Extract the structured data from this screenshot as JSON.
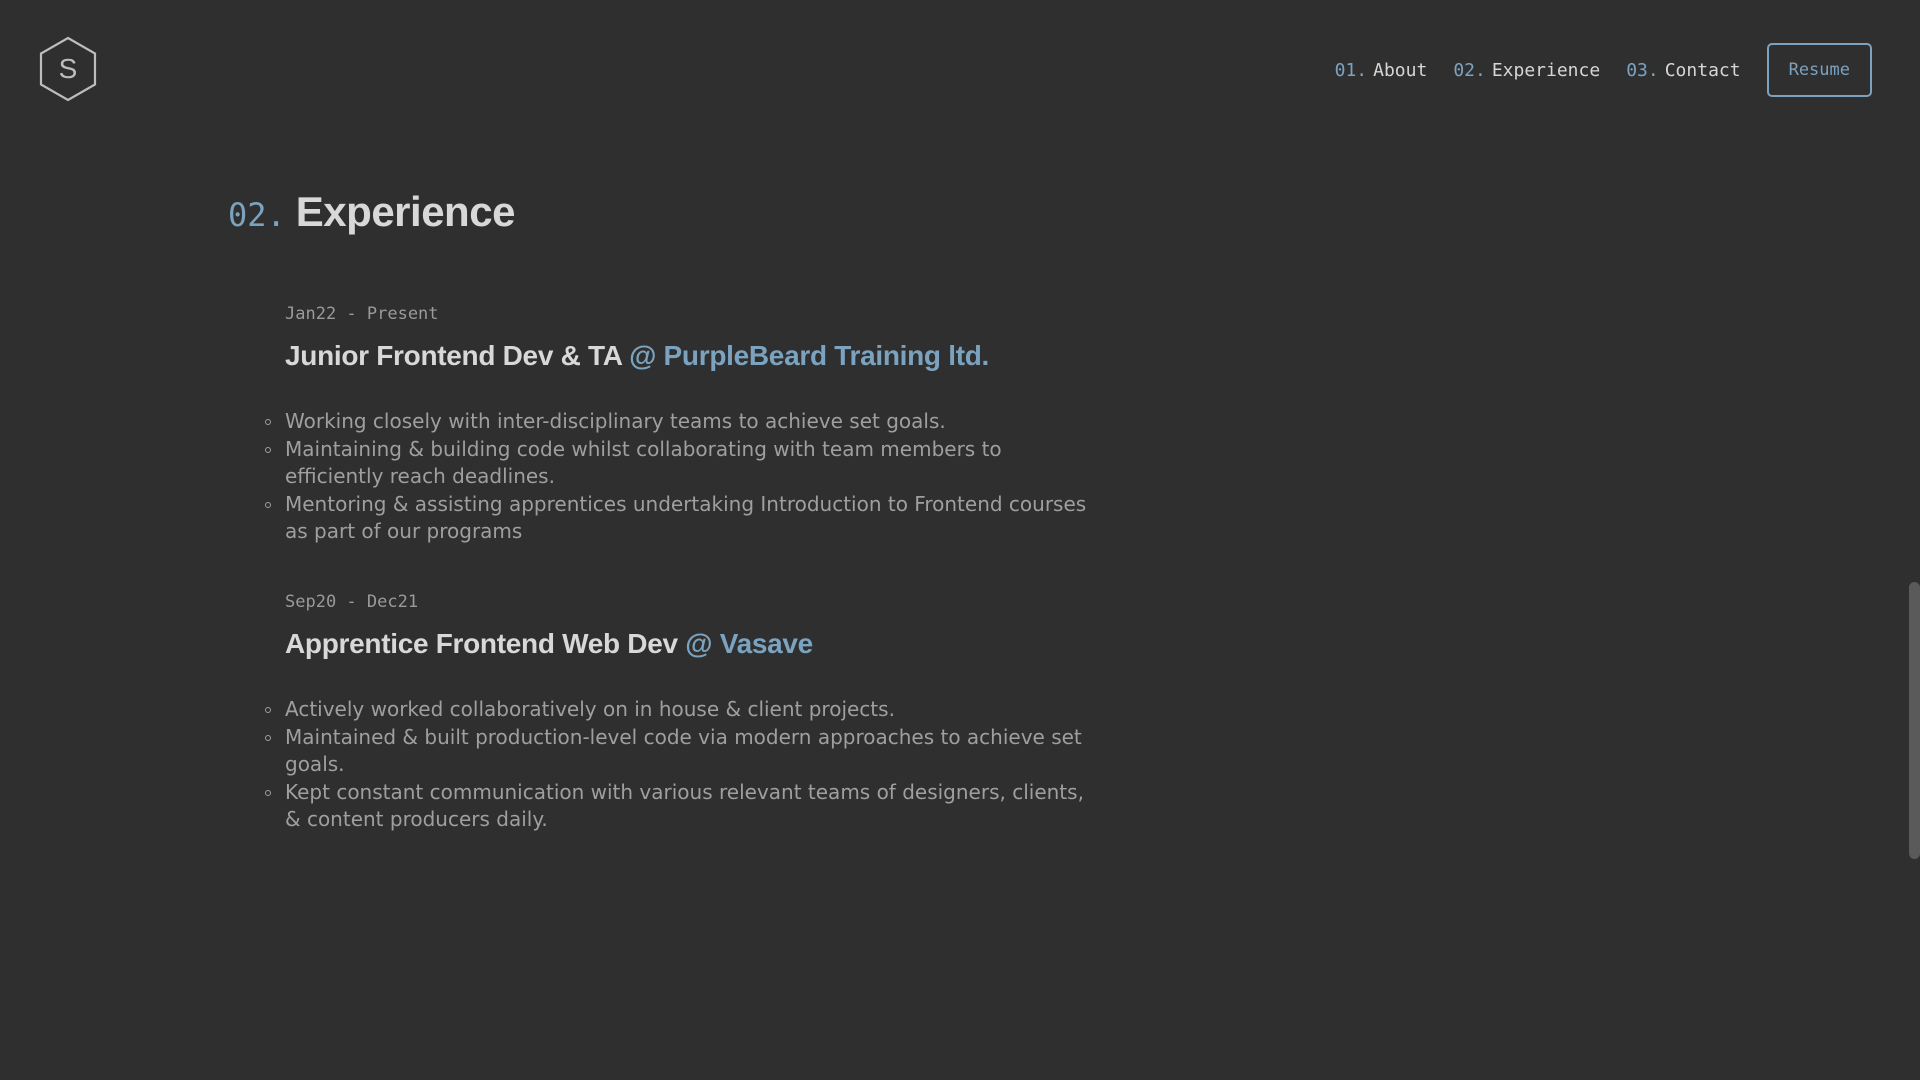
{
  "logo": {
    "letter": "S"
  },
  "nav": {
    "items": [
      {
        "num": "01.",
        "label": "About"
      },
      {
        "num": "02.",
        "label": "Experience"
      },
      {
        "num": "03.",
        "label": "Contact"
      }
    ],
    "resume_label": "Resume"
  },
  "section": {
    "num": "02.",
    "title": "Experience"
  },
  "jobs": [
    {
      "date": "Jan22 - Present",
      "title": "Junior Frontend Dev & TA",
      "company": "@ PurpleBeard Training ltd.",
      "bullets": [
        "Working closely with inter-disciplinary teams to achieve set goals.",
        "Maintaining & building code whilst collaborating with team members to efficiently reach deadlines.",
        "Mentoring & assisting apprentices undertaking Introduction to Frontend courses as part of our programs"
      ]
    },
    {
      "date": "Sep20 - Dec21",
      "title": "Apprentice Frontend Web Dev",
      "company": "@ Vasave",
      "bullets": [
        "Actively worked collaboratively on in house & client projects.",
        "Maintained & built production-level code via modern approaches to achieve set goals.",
        "Kept constant communication with various relevant teams of designers, clients, & content producers daily."
      ]
    }
  ],
  "colors": {
    "background": "#2f2f2f",
    "accent": "#7ba3c0",
    "text": "#d8d8d8",
    "muted": "#9f9f9f"
  },
  "icons": {
    "logo": "hexagon-s-logo-icon"
  }
}
